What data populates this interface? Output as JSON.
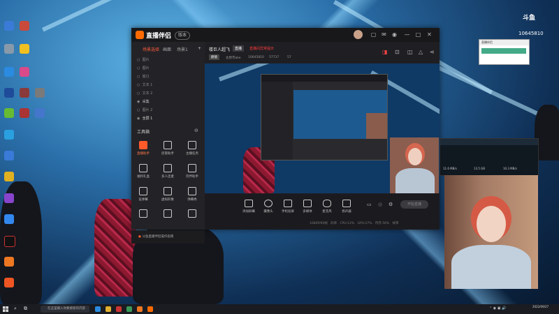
{
  "colors": {
    "accent": "#ff5a2a",
    "live_status": "#ff3b3b",
    "panel_bg": "#1f1f23",
    "wallpaper_light": "#5fb6e8"
  },
  "desktop": {
    "counter_logo": "斗鱼",
    "counter_value": "10645810",
    "notification_head": "直播伴侣",
    "netwin_values": [
      "11.6 MB/s",
      "13.5 GB",
      "10.3 MB/s"
    ]
  },
  "app": {
    "title": "直播伴侣",
    "version": "版本",
    "titlebar_icons": [
      "gift-icon",
      "mail-icon",
      "broadcast-icon",
      "minimize-icon",
      "maximize-icon",
      "close-icon"
    ],
    "left_tabs": [
      "场景选择",
      "画面",
      "场景1"
    ],
    "sources": [
      "图片",
      "图片",
      "窗口",
      "文本 1",
      "文本 2",
      "采集",
      "图片 2",
      "全屏 1"
    ],
    "tools_title": "工具箱",
    "tools": [
      {
        "label": "直播助手",
        "icon": "assistant-icon",
        "hot": true
      },
      {
        "label": "房管助手",
        "icon": "admin-icon",
        "hot": false
      },
      {
        "label": "主播任务",
        "icon": "task-icon",
        "hot": false
      },
      {
        "label": "福利礼盒",
        "icon": "gift-box-icon",
        "hot": false
      },
      {
        "label": "多人连麦",
        "icon": "multi-mic-icon",
        "hot": false
      },
      {
        "label": "玩伴助手",
        "icon": "partner-icon",
        "hot": false
      },
      {
        "label": "设弹幕",
        "icon": "danmaku-icon",
        "hot": false
      },
      {
        "label": "虚拟形象",
        "icon": "avatar-tool-icon",
        "hot": false
      },
      {
        "label": "弹幕秀",
        "icon": "show-icon",
        "hot": false
      }
    ],
    "notice": "斗鱼直播伴侣操作指南",
    "room": {
      "name": "楼巨人超飞",
      "tag": "直播",
      "status": "直播间异常提示",
      "category": "颜值",
      "meta": [
        "太原市ake",
        "10645810",
        "57737",
        "57"
      ]
    },
    "controls": [
      {
        "label": "添加屏幕",
        "icon": "screen-icon"
      },
      {
        "label": "摄像头",
        "icon": "camera-icon"
      },
      {
        "label": "手机投屏",
        "icon": "phone-icon"
      },
      {
        "label": "多媒体",
        "icon": "media-icon"
      },
      {
        "label": "麦克风",
        "icon": "microphone-icon"
      },
      {
        "label": "扬声器",
        "icon": "speaker-icon"
      }
    ],
    "go_live": "开始直播",
    "status_line": [
      "1080P/60帧",
      "码率",
      "CPU:12%",
      "GPU:27%",
      "内存:56%",
      "帧率"
    ]
  },
  "taskbar": {
    "search_placeholder": "在这里输入你要搜索的内容",
    "clock_time": "",
    "clock_date": "2022/09/27"
  }
}
